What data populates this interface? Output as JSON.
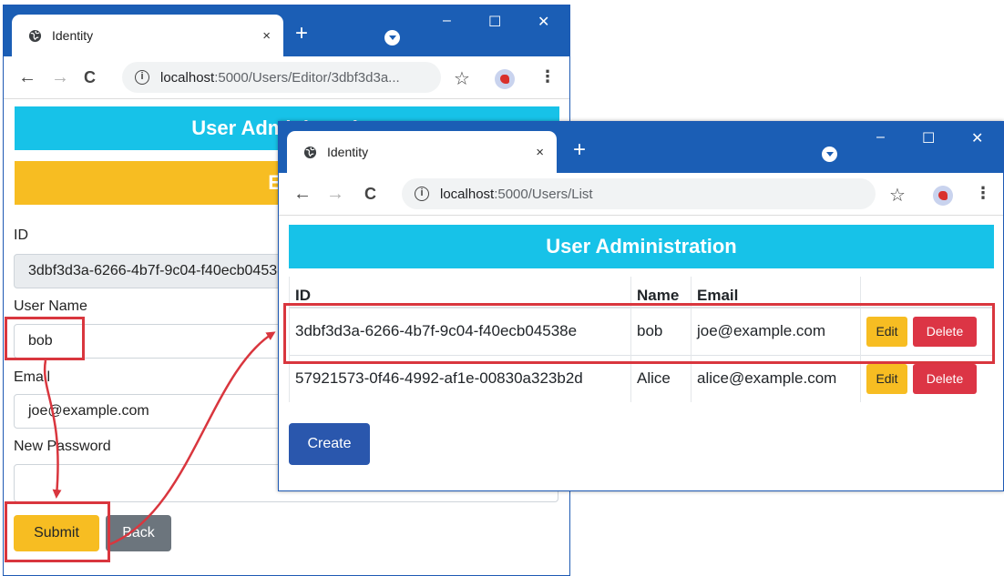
{
  "back_window": {
    "tab_title": "Identity",
    "url_host": "localhost",
    "url_rest": ":5000/Users/Editor/3dbf3d3a...",
    "banner_title": "User Administration",
    "banner_sub": "Edit",
    "fields": {
      "id_label": "ID",
      "id_value": "3dbf3d3a-6266-4b7f-9c04-f40ecb04538e",
      "username_label": "User Name",
      "username_value": "bob",
      "email_label": "Email",
      "email_value": "joe@example.com",
      "password_label": "New Password",
      "password_value": ""
    },
    "submit_label": "Submit",
    "back_label": "Back"
  },
  "front_window": {
    "tab_title": "Identity",
    "url_host": "localhost",
    "url_rest": ":5000/Users/List",
    "banner_title": "User Administration",
    "columns": [
      "ID",
      "Name",
      "Email",
      ""
    ],
    "rows": [
      {
        "id": "3dbf3d3a-6266-4b7f-9c04-f40ecb04538e",
        "name": "bob",
        "email": "joe@example.com",
        "edit": "Edit",
        "delete": "Delete"
      },
      {
        "id": "57921573-0f46-4992-af1e-00830a323b2d",
        "name": "Alice",
        "email": "alice@example.com",
        "edit": "Edit",
        "delete": "Delete"
      }
    ],
    "create_label": "Create"
  },
  "glyphs": {
    "close": "×",
    "new_tab": "+",
    "minimize": "–",
    "maximize": "☐",
    "window_close": "✕",
    "back": "←",
    "forward": "→",
    "reload": "C",
    "info": "i",
    "star": "☆",
    "menu": "⋮"
  },
  "colors": {
    "chrome_blue": "#1b5eb5",
    "info": "#17c2e8",
    "warning": "#f7bd22",
    "primary": "#2a57ad",
    "danger": "#dc3545",
    "secondary": "#6c757d",
    "highlight": "#d9363e"
  }
}
